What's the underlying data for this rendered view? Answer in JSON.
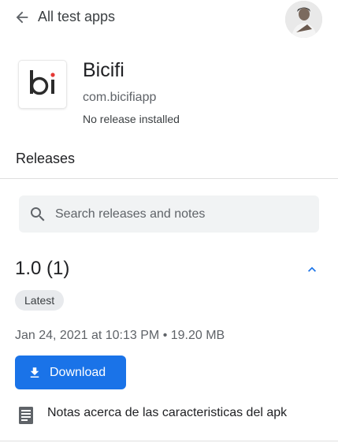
{
  "header": {
    "back_label": "All test apps",
    "avatar_icon": "user-avatar"
  },
  "app": {
    "icon_text": "bi",
    "name": "Bicifi",
    "package": "com.bicifiapp",
    "status": "No release installed"
  },
  "releases": {
    "title": "Releases",
    "search": {
      "placeholder": "Search releases and notes",
      "value": ""
    },
    "items": [
      {
        "version": "1.0 (1)",
        "badge": "Latest",
        "meta": "Jan 24, 2021 at 10:13 PM • 19.20 MB",
        "download_label": "Download",
        "notes": "Notas acerca de las caracteristicas del apk"
      }
    ]
  },
  "colors": {
    "accent": "#1a73e8",
    "chip_bg": "#e8eaed",
    "search_bg": "#f1f3f4"
  }
}
